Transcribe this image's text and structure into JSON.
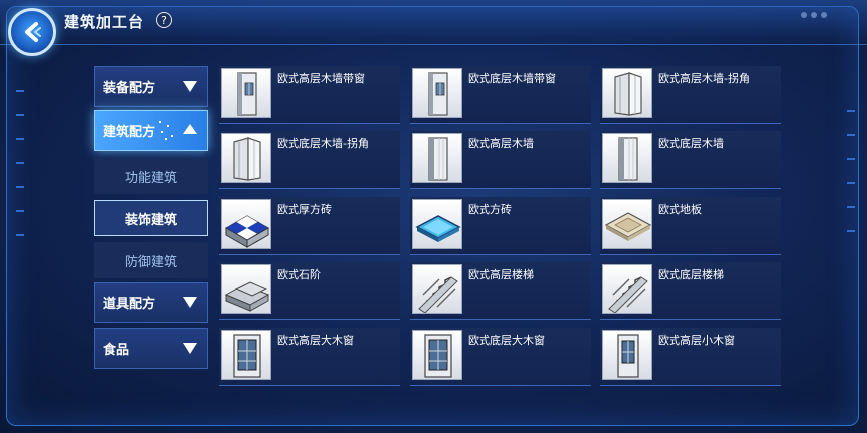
{
  "header": {
    "title": "建筑加工台",
    "help_glyph": "?"
  },
  "menu": {
    "categories": [
      {
        "label": "装备配方"
      },
      {
        "label": "建筑配方"
      },
      {
        "label": "道具配方"
      },
      {
        "label": "食品"
      }
    ],
    "subcategories": [
      {
        "label": "功能建筑"
      },
      {
        "label": "装饰建筑"
      },
      {
        "label": "防御建筑"
      }
    ]
  },
  "items": [
    {
      "name": "欧式高层木墙带窗",
      "icon": "wall-window-icon"
    },
    {
      "name": "欧式底层木墙带窗",
      "icon": "wall-window-icon"
    },
    {
      "name": "欧式高层木墙-拐角",
      "icon": "wall-corner-icon"
    },
    {
      "name": "欧式底层木墙-拐角",
      "icon": "wall-corner-icon"
    },
    {
      "name": "欧式高层木墙",
      "icon": "wall-icon"
    },
    {
      "name": "欧式底层木墙",
      "icon": "wall-icon"
    },
    {
      "name": "欧式厚方砖",
      "icon": "thick-tile-icon"
    },
    {
      "name": "欧式方砖",
      "icon": "tile-icon"
    },
    {
      "name": "欧式地板",
      "icon": "floor-icon"
    },
    {
      "name": "欧式石阶",
      "icon": "stone-step-icon"
    },
    {
      "name": "欧式高层楼梯",
      "icon": "stairs-icon"
    },
    {
      "name": "欧式底层楼梯",
      "icon": "stairs-icon"
    },
    {
      "name": "欧式高层大木窗",
      "icon": "large-window-icon"
    },
    {
      "name": "欧式底层大木窗",
      "icon": "large-window-icon"
    },
    {
      "name": "欧式高层小木窗",
      "icon": "small-window-icon"
    }
  ],
  "colors": {
    "accent": "#4aa6ff",
    "panel": "#182c5a",
    "border": "#3c67b8"
  }
}
